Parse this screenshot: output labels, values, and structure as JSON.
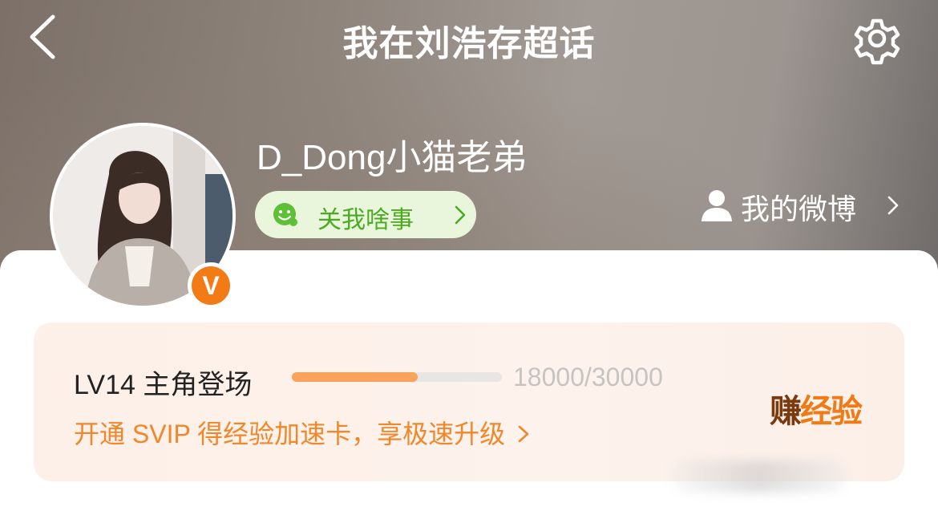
{
  "header": {
    "title": "我在刘浩存超话",
    "back_icon": "chevron-left-icon",
    "settings_icon": "gear-icon"
  },
  "profile": {
    "username": "D_Dong小猫老弟",
    "status_pill": "关我啥事",
    "status_icon": "smiley-emoji-icon",
    "verified_badge": "V",
    "my_weibo_label": "我的微博"
  },
  "level_card": {
    "level_label": "LV14 主角登场",
    "progress_text": "18000/30000",
    "progress_fraction": 0.6,
    "promo_text": "开通 SVIP 得经验加速卡，享极速升级",
    "earn_first_char": "赚",
    "earn_rest": "经验"
  },
  "colors": {
    "accent_orange": "#f0872a",
    "pill_green": "#4caa22",
    "pill_bg": "#e9f6dc",
    "progress_fill": "#f7a35c"
  }
}
